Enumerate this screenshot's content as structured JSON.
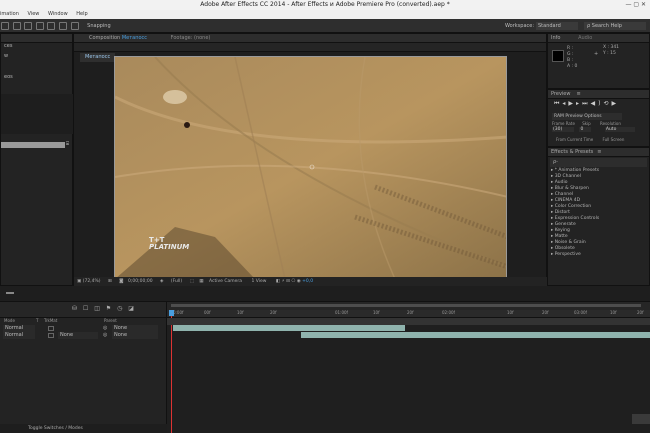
{
  "window": {
    "title": "Adobe After Effects CC 2014 - After Effects и Adobe Premiere Pro (converted).aep *"
  },
  "menu": {
    "items": [
      "imation",
      "View",
      "Window",
      "Help"
    ]
  },
  "toolbar": {
    "snapping": "Snapping",
    "workspace_label": "Workspace:",
    "workspace_value": "Standard",
    "search_placeholder": "Search Help"
  },
  "project_panel": {
    "items": [
      "ces",
      "w",
      "eos"
    ]
  },
  "composition": {
    "tab_label": "Composition",
    "tab_name": "Метапосс",
    "footage_label": "Footage: (none)",
    "subtab": "Метапосс",
    "zoom": "(72,4%)",
    "timecode": "0;00;00;00",
    "resolution": "(Full)",
    "camera": "Active Camera",
    "view": "1 View",
    "overlay_line1": "T+T",
    "overlay_line2": "PLATINUM"
  },
  "info": {
    "tab": "Info",
    "tab2": "Audio",
    "r": "R :",
    "g": "G :",
    "b": "B :",
    "a": "A : 0",
    "x": "X : 341",
    "y": "Y : 15"
  },
  "preview": {
    "tab": "Preview",
    "ram_options": "RAM Preview Options",
    "frame_rate_label": "Frame Rate",
    "skip_label": "Skip",
    "resolution_label": "Resolution",
    "frame_rate": "(30)",
    "skip": "0",
    "resolution": "Auto",
    "from_current": "From Current Time",
    "full_screen": "Full Screen"
  },
  "effects": {
    "tab": "Effects & Presets",
    "search": "ρ-",
    "items": [
      "* Animation Presets",
      "3D Channel",
      "Audio",
      "Blur & Sharpen",
      "Channel",
      "CINEMA 4D",
      "Color Correction",
      "Distort",
      "Expression Controls",
      "Generate",
      "Keying",
      "Matte",
      "Noise & Grain",
      "Obsolete",
      "Perspective"
    ]
  },
  "timeline": {
    "col_mode": "Mode",
    "col_t": "T",
    "col_trkmat": "TrkMat",
    "col_parent": "Parent",
    "layers": [
      {
        "mode": "Normal",
        "trkmat": "",
        "parent": "None"
      },
      {
        "mode": "Normal",
        "trkmat": "None",
        "parent": "None"
      }
    ],
    "ruler": [
      "0:00f",
      "00f",
      "10f",
      "20f",
      "01:00f",
      "10f",
      "20f",
      "02:00f",
      "10f",
      "20f",
      "03:00f",
      "10f",
      "20f"
    ],
    "toggle": "Toggle Switches / Modes"
  }
}
